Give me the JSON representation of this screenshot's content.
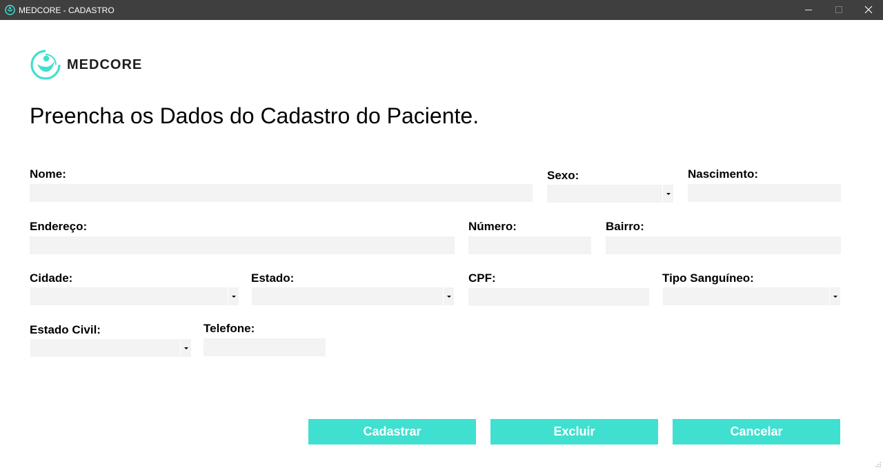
{
  "window": {
    "title": "MEDCORE - CADASTRO",
    "icon": "medcore-logo-icon",
    "controls": [
      "minimize-icon",
      "maximize-icon",
      "close-icon"
    ]
  },
  "brand": {
    "name": "MEDCORE",
    "color": "#40e0d0"
  },
  "page": {
    "heading": "Preencha os Dados do Cadastro do Paciente."
  },
  "form": {
    "nome": {
      "label": "Nome:",
      "value": ""
    },
    "sexo": {
      "label": "Sexo:",
      "value": ""
    },
    "nascimento": {
      "label": "Nascimento:",
      "value": ""
    },
    "endereco": {
      "label": "Endereço:",
      "value": ""
    },
    "numero": {
      "label": "Número:",
      "value": ""
    },
    "bairro": {
      "label": "Bairro:",
      "value": ""
    },
    "cidade": {
      "label": "Cidade:",
      "value": ""
    },
    "estado": {
      "label": "Estado:",
      "value": ""
    },
    "cpf": {
      "label": "CPF:",
      "value": ""
    },
    "tipo_sanguineo": {
      "label": "Tipo Sanguíneo:",
      "value": ""
    },
    "estado_civil": {
      "label": "Estado Civil:",
      "value": ""
    },
    "telefone": {
      "label": "Telefone:",
      "value": ""
    }
  },
  "actions": {
    "cadastrar": "Cadastrar",
    "excluir": "Excluir",
    "cancelar": "Cancelar",
    "button_color": "#40e0d0"
  },
  "colors": {
    "titlebar": "#3f3f3f",
    "field_bg": "#f3f3f3",
    "accent": "#40e0d0"
  }
}
